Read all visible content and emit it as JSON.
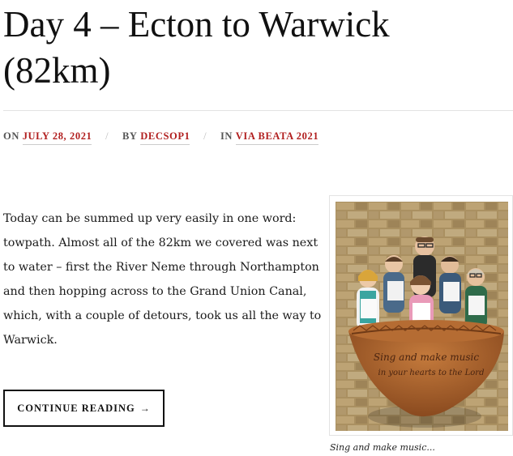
{
  "post": {
    "title": "Day 4 – Ecton to Warwick (82km)",
    "meta": {
      "on_label": "ON",
      "date": "JULY 28, 2021",
      "separator": "/",
      "by_label": "BY",
      "author": "DECSOP1",
      "in_label": "IN",
      "category": "VIA BEATA 2021"
    },
    "excerpt": "Today can be summed up very easily in one word: towpath. Almost all of the 82km we covered was next to water – first the River Neme through Northampton and then hopping across to the Grand Union Canal, which, with a couple of detours, took us all the way to Warwick.",
    "continue_label": "CONTINUE READING",
    "continue_arrow": "→",
    "image": {
      "caption": "Sing and make music...",
      "inscription_line1": "Sing and make music",
      "inscription_line2": "in your hearts to the Lord"
    }
  },
  "colors": {
    "link": "#b11f1f",
    "text": "#1a1a1a",
    "divider": "#e3e3e3",
    "stone_wall": "#b59a68",
    "wooden_bowl": "#a7602b"
  }
}
